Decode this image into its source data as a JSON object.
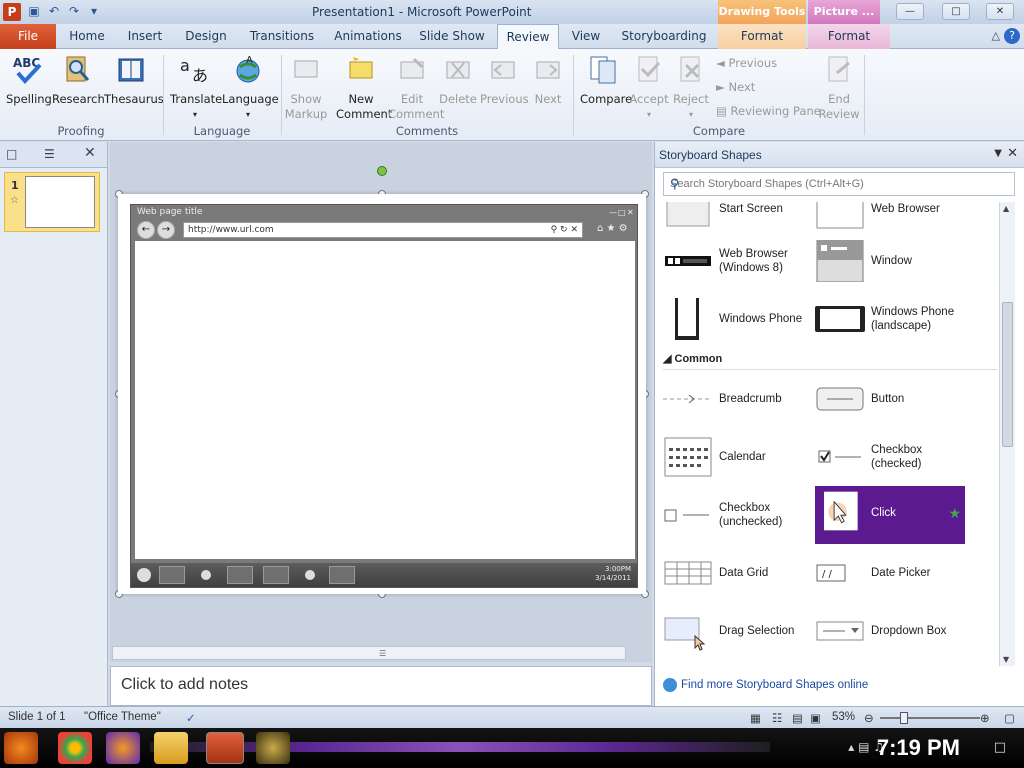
{
  "window": {
    "title": "Presentation1 - Microsoft PowerPoint",
    "context_drawing": "Drawing Tools",
    "context_picture": "Picture ..."
  },
  "tabs": {
    "file": "File",
    "items": [
      "Home",
      "Insert",
      "Design",
      "Transitions",
      "Animations",
      "Slide Show",
      "Review",
      "View",
      "Storyboarding",
      "Format",
      "Format"
    ],
    "active": "Review"
  },
  "ribbon": {
    "proofing": {
      "label": "Proofing",
      "spelling": "Spelling",
      "research": "Research",
      "thesaurus": "Thesaurus"
    },
    "language": {
      "label": "Language",
      "translate": "Translate",
      "language": "Language"
    },
    "comments": {
      "label": "Comments",
      "show_markup_1": "Show",
      "show_markup_2": "Markup",
      "new_comment_1": "New",
      "new_comment_2": "Comment",
      "edit_comment_1": "Edit",
      "edit_comment_2": "Comment",
      "delete": "Delete",
      "previous": "Previous",
      "next": "Next"
    },
    "compare": {
      "label": "Compare",
      "compare": "Compare",
      "accept": "Accept",
      "reject": "Reject",
      "previous": "Previous",
      "next": "Next",
      "reviewing_pane": "Reviewing Pane",
      "end_review_1": "End",
      "end_review_2": "Review"
    }
  },
  "slide_panel": {
    "slide_number": "1"
  },
  "slide": {
    "browser_title": "Web page title",
    "url": "http://www.url.com",
    "clock_time": "3:00PM",
    "clock_date": "3/14/2011"
  },
  "notes": {
    "placeholder": "Click to add notes"
  },
  "pane": {
    "title": "Storyboard Shapes",
    "search_placeholder": "Search Storyboard Shapes (Ctrl+Alt+G)",
    "section_common": "Common",
    "shapes": {
      "start_screen": "Start Screen",
      "web_browser": "Web Browser",
      "web_browser_w8_1": "Web Browser",
      "web_browser_w8_2": "(Windows 8)",
      "window": "Window",
      "windows_phone": "Windows Phone",
      "windows_phone_land_1": "Windows Phone",
      "windows_phone_land_2": "(landscape)",
      "breadcrumb": "Breadcrumb",
      "button": "Button",
      "calendar": "Calendar",
      "checkbox_checked_1": "Checkbox",
      "checkbox_checked_2": "(checked)",
      "checkbox_unchecked_1": "Checkbox",
      "checkbox_unchecked_2": "(unchecked)",
      "click": "Click",
      "data_grid": "Data Grid",
      "date_picker": "Date Picker",
      "drag_selection": "Drag Selection",
      "dropdown_box": "Dropdown Box"
    },
    "footer": "Find more Storyboard Shapes online"
  },
  "status": {
    "slide": "Slide 1 of 1",
    "theme": "\"Office Theme\"",
    "zoom": "53%"
  },
  "taskbar": {
    "time": "7:19 PM"
  },
  "colors": {
    "selected_shape": "#5b1a8f",
    "file_tab": "#c5401b"
  }
}
